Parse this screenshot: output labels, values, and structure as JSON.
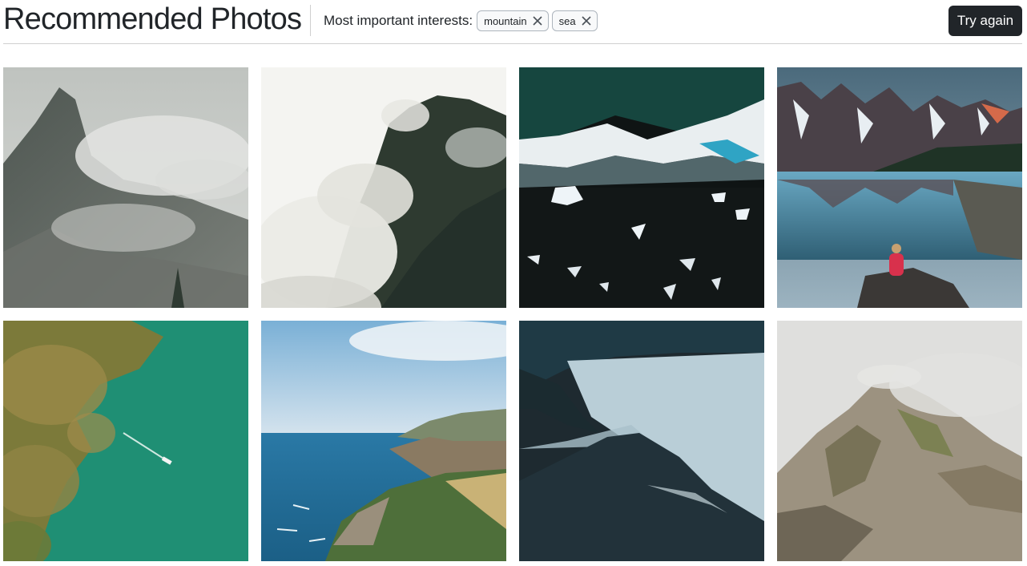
{
  "header": {
    "title": "Recommended Photos",
    "interests_label": "Most important interests:",
    "tags": [
      {
        "label": "mountain",
        "icon": "close-icon"
      },
      {
        "label": "sea",
        "icon": "close-icon"
      }
    ],
    "try_again_label": "Try again"
  },
  "colors": {
    "button_bg": "#212529",
    "tag_border": "#adb5bd",
    "divider": "#cfcfcf"
  },
  "photos": [
    {
      "subject": "misty-mountain-peak"
    },
    {
      "subject": "clouds-over-forested-ridge"
    },
    {
      "subject": "waves-on-black-sand-ice"
    },
    {
      "subject": "lake-reflection-person-red-jacket"
    },
    {
      "subject": "aerial-green-sea-boat"
    },
    {
      "subject": "coastal-cliffs-blue-sea"
    },
    {
      "subject": "fog-mountain-ridge"
    },
    {
      "subject": "rocky-peak-in-fog"
    }
  ]
}
